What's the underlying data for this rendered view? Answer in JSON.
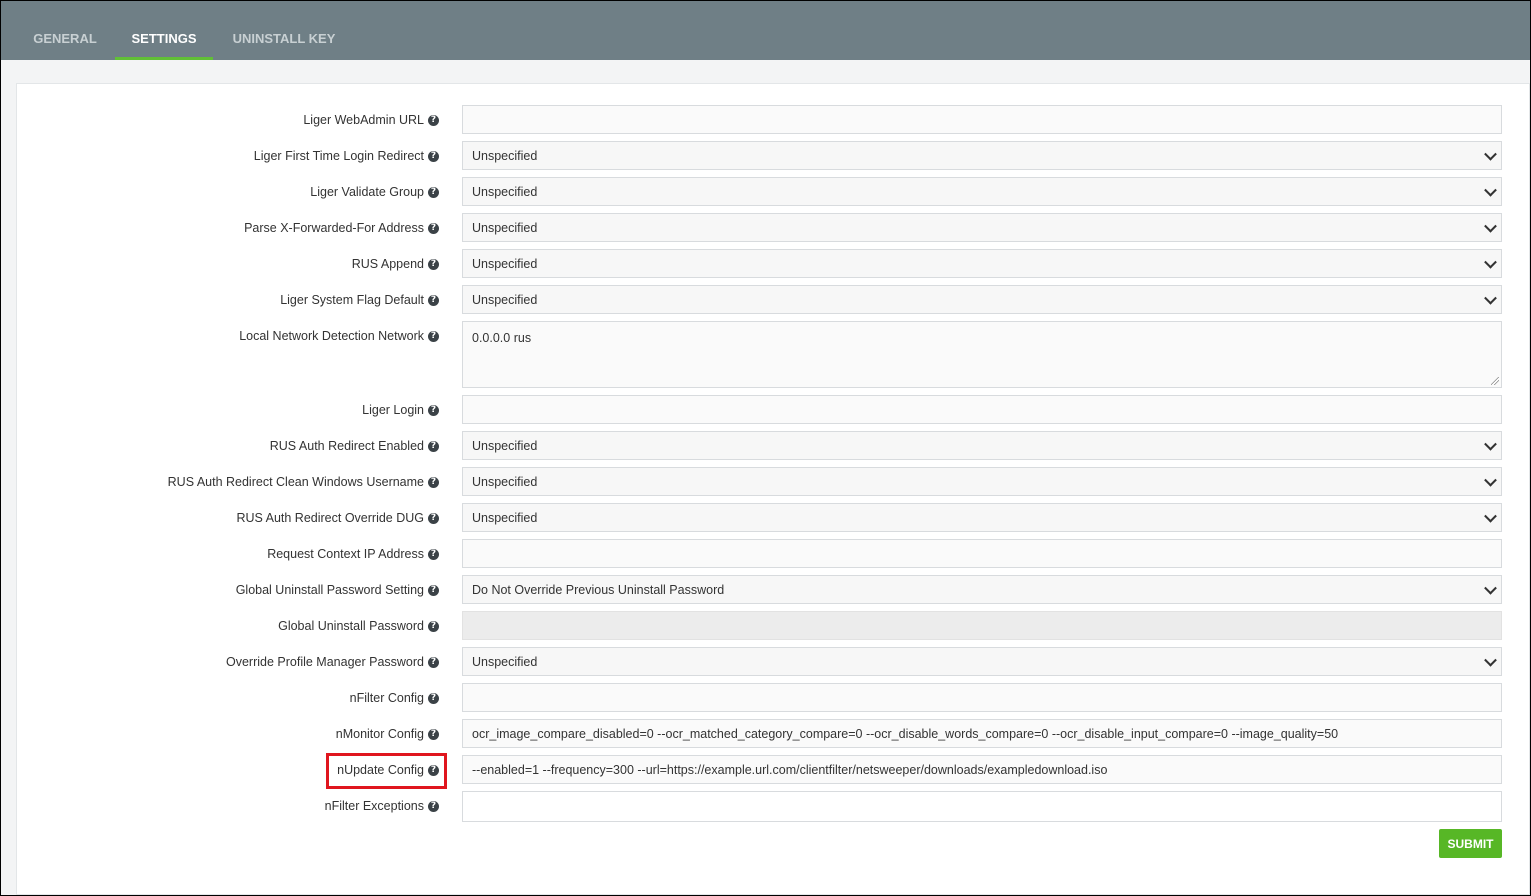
{
  "tabs": [
    {
      "label": "GENERAL"
    },
    {
      "label": "SETTINGS"
    },
    {
      "label": "UNINSTALL KEY"
    }
  ],
  "fields": [
    {
      "label": "Liger WebAdmin URL",
      "type": "input",
      "value": ""
    },
    {
      "label": "Liger First Time Login Redirect",
      "type": "select",
      "value": "Unspecified"
    },
    {
      "label": "Liger Validate Group",
      "type": "select",
      "value": "Unspecified"
    },
    {
      "label": "Parse X-Forwarded-For Address",
      "type": "select",
      "value": "Unspecified"
    },
    {
      "label": "RUS Append",
      "type": "select",
      "value": "Unspecified"
    },
    {
      "label": "Liger System Flag Default",
      "type": "select",
      "value": "Unspecified"
    },
    {
      "label": "Local Network Detection Network",
      "type": "textarea",
      "value": "0.0.0.0 rus"
    },
    {
      "label": "Liger Login",
      "type": "input",
      "value": ""
    },
    {
      "label": "RUS Auth Redirect Enabled",
      "type": "select",
      "value": "Unspecified"
    },
    {
      "label": "RUS Auth Redirect Clean Windows Username",
      "type": "select",
      "value": "Unspecified"
    },
    {
      "label": "RUS Auth Redirect Override DUG",
      "type": "select",
      "value": "Unspecified"
    },
    {
      "label": "Request Context IP Address",
      "type": "input",
      "value": ""
    },
    {
      "label": "Global Uninstall Password Setting",
      "type": "select",
      "value": "Do Not Override Previous Uninstall Password"
    },
    {
      "label": "Global Uninstall Password",
      "type": "disabled",
      "value": ""
    },
    {
      "label": "Override Profile Manager Password",
      "type": "select",
      "value": "Unspecified"
    },
    {
      "label": "nFilter Config",
      "type": "input",
      "value": ""
    },
    {
      "label": "nMonitor Config",
      "type": "input",
      "value": "ocr_image_compare_disabled=0 --ocr_matched_category_compare=0 --ocr_disable_words_compare=0 --ocr_disable_input_compare=0 --image_quality=50"
    },
    {
      "label": "nUpdate Config",
      "type": "input",
      "value": "--enabled=1 --frequency=300 --url=https://example.url.com/clientfilter/netsweeper/downloads/exampledownload.iso"
    },
    {
      "label": "nFilter Exceptions",
      "type": "input",
      "value": ""
    }
  ],
  "help_glyph": "?",
  "submit_label": "SUBMIT",
  "colors": {
    "tabbar": "#6f7f86",
    "accent": "#61c036",
    "submit": "#57b726",
    "highlight": "#e0161e"
  }
}
